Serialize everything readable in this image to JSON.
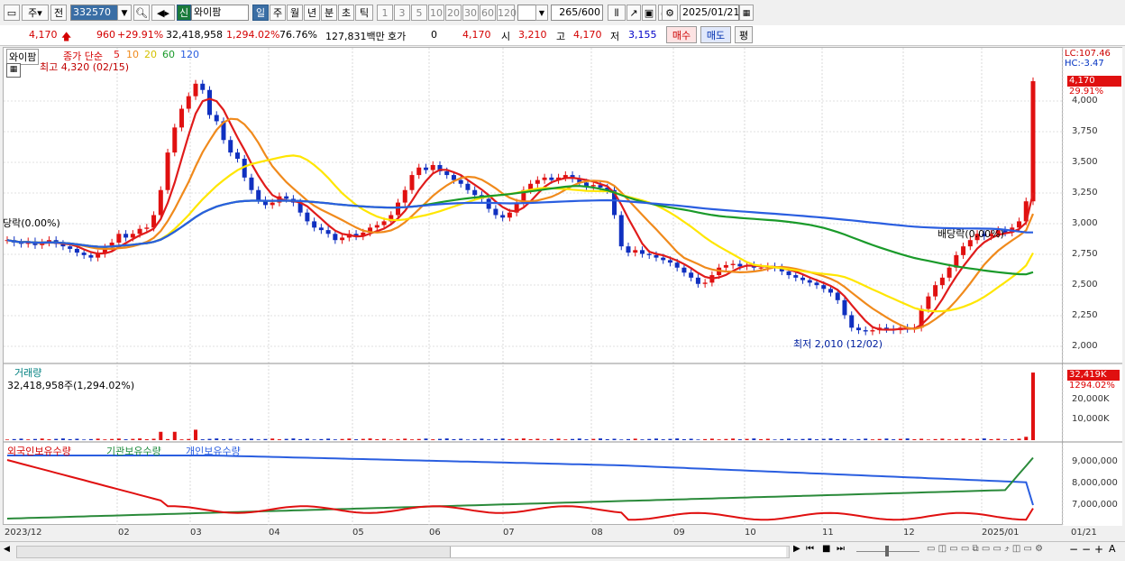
{
  "toolbar": {
    "market": "주",
    "prev": "전",
    "code": "332570",
    "name": "와이팜",
    "badge": "신",
    "periods": [
      "일",
      "주",
      "월",
      "년",
      "분",
      "초",
      "틱"
    ],
    "selected_period": "일",
    "intervals": [
      "1",
      "3",
      "5",
      "10",
      "20",
      "30",
      "60",
      "120"
    ],
    "count": "265",
    "count_total": "/600",
    "date": "2025/01/21"
  },
  "infobar": {
    "price": "4,170",
    "change": "960",
    "change_pct": "+29.91%",
    "volume": "32,418,958",
    "vol_ratio": "1,294.02%",
    "turnover": "76.76%",
    "amount": "127,831백만",
    "hoga_label": "호가",
    "hoga_value": "0",
    "hoga_price": "4,170",
    "open_label": "시",
    "open": "3,210",
    "high_label": "고",
    "high": "4,170",
    "low_label": "저",
    "low": "3,155",
    "buy": "매수",
    "sell": "매도",
    "avg": "평"
  },
  "price_panel": {
    "stock": "와이팜",
    "legend_prefix": "종가 단순",
    "ma": [
      {
        "label": "5",
        "color": "#e01b1b"
      },
      {
        "label": "10",
        "color": "#f08a1c"
      },
      {
        "label": "20",
        "color": "#ffe600"
      },
      {
        "label": "60",
        "color": "#1a9a2a"
      },
      {
        "label": "120",
        "color": "#2a5ee0"
      }
    ],
    "high_note": "최고 4,320 (02/15)",
    "low_note": "최저 2,010 (12/02)",
    "left_note": "당락(0.00%)",
    "div_note": "배당락(0.00%)",
    "lc": "LC:107.46",
    "hc": "HC:-3.47",
    "last_price": "4,170",
    "last_pct": "29.91%",
    "yticks": [
      "4,000",
      "3,750",
      "3,500",
      "3,250",
      "3,000",
      "2,750",
      "2,500",
      "2,250",
      "2,000"
    ]
  },
  "volume_panel": {
    "title": "거래량",
    "value": "32,418,958주(1,294.02%)",
    "last": "32,419K",
    "last_pct": "1294.02%",
    "yticks": [
      "20,000K",
      "10,000K"
    ]
  },
  "holder_panel": {
    "s1": "외국인보유수량",
    "s2": "기관보유수량",
    "s3": "개인보유수량",
    "yticks": [
      "9,000,000",
      "8,000,000",
      "7,000,000"
    ]
  },
  "xaxis": [
    "2023/12",
    "02",
    "03",
    "04",
    "05",
    "06",
    "07",
    "08",
    "09",
    "10",
    "11",
    "12",
    "2025/01",
    "01/21"
  ],
  "chart_data": {
    "type": "candlestick",
    "ylim": [
      1950,
      4300
    ],
    "close": [
      2900,
      2880,
      2870,
      2890,
      2860,
      2880,
      2900,
      2870,
      2850,
      2830,
      2800,
      2780,
      2760,
      2790,
      2840,
      2880,
      2950,
      2920,
      2950,
      2990,
      3000,
      3100,
      3300,
      3600,
      3800,
      3950,
      4050,
      4150,
      4100,
      3900,
      3850,
      3700,
      3600,
      3550,
      3400,
      3300,
      3220,
      3180,
      3200,
      3250,
      3230,
      3200,
      3120,
      3050,
      3000,
      2980,
      2950,
      2900,
      2920,
      2950,
      2930,
      2960,
      3000,
      3020,
      3050,
      3100,
      3200,
      3300,
      3420,
      3480,
      3460,
      3500,
      3450,
      3420,
      3380,
      3350,
      3300,
      3260,
      3230,
      3150,
      3100,
      3080,
      3120,
      3200,
      3300,
      3350,
      3380,
      3400,
      3380,
      3400,
      3420,
      3390,
      3360,
      3330,
      3340,
      3320,
      3300,
      3100,
      2850,
      2800,
      2820,
      2790,
      2780,
      2760,
      2740,
      2720,
      2680,
      2640,
      2600,
      2550,
      2560,
      2620,
      2680,
      2700,
      2710,
      2690,
      2700,
      2680,
      2680,
      2690,
      2680,
      2650,
      2620,
      2600,
      2580,
      2560,
      2540,
      2510,
      2480,
      2420,
      2300,
      2200,
      2180,
      2170,
      2180,
      2200,
      2190,
      2180,
      2200,
      2190,
      2200,
      2350,
      2450,
      2540,
      2600,
      2680,
      2780,
      2850,
      2900,
      2950,
      2930,
      2950,
      2980,
      2960,
      3000,
      3050,
      3210,
      4170
    ]
  }
}
